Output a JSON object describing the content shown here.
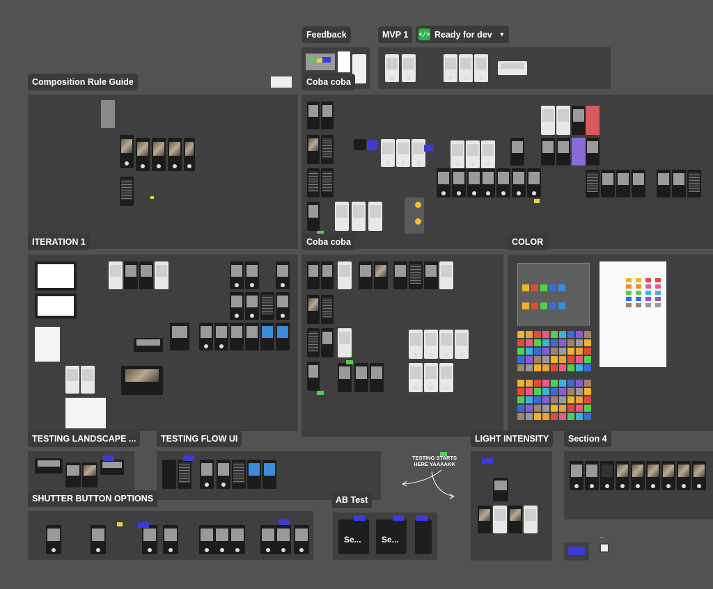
{
  "canvas": {
    "labels": {
      "feedback": "Feedback",
      "mvp1": "MVP 1",
      "status": "Ready for dev",
      "composition": "Composition Rule Guide",
      "coba1": "Coba coba",
      "iteration1": "ITERATION 1",
      "coba2": "Coba coba",
      "color": "COLOR",
      "testing_landscape": "TESTING LANDSCAPE ...",
      "testing_flow": "TESTING FLOW UI",
      "light_intensity": "LIGHT INTENSITY",
      "section4": "Section 4",
      "shutter": "SHUTTER BUTTON OPTIONS",
      "ab_test": "AB Test"
    },
    "ab_cards": [
      "Se...",
      "Se..."
    ],
    "note_text": "TESTING STARTS\nHERE YAAAAKK",
    "more": "...",
    "colors": {
      "canvas_bg": "#525252",
      "section_bg": "#3f3f3f",
      "label_bg": "#3a3a3a",
      "status_green": "#2fb14a",
      "sticky_blue": "#3b3bd8",
      "sticky_yellow": "#e8d33a"
    },
    "palette": [
      "#f0b429",
      "#e8a33a",
      "#e04a3a",
      "#e85a8a",
      "#4ed14e",
      "#3bb3d8",
      "#3b6bd8",
      "#8a5ad8",
      "#a0846a",
      "#9a9a9a"
    ],
    "icons": [
      "code-icon",
      "chevron-down-icon"
    ]
  }
}
